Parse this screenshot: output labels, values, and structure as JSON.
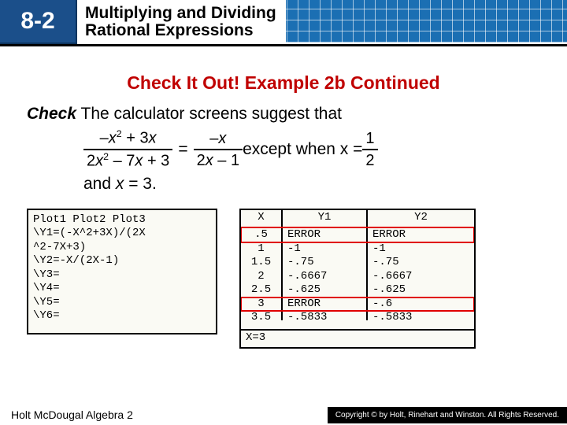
{
  "header": {
    "lesson": "8-2",
    "title_l1": "Multiplying and Dividing",
    "title_l2": "Rational Expressions"
  },
  "subtitle": "Check It Out! Example 2b Continued",
  "body": {
    "lead_strong": "Check",
    "lead_rest": " The calculator screens suggest that",
    "frac1_num": "–x² + 3x",
    "frac1_den": "2x² – 7x + 3",
    "eq": "=",
    "frac2_num": "–x",
    "frac2_den": "2x – 1",
    "mid": " except when x = ",
    "frac3_num": "1",
    "frac3_den": "2",
    "tail": "and x = 3."
  },
  "screen1": {
    "l1": "Plot1 Plot2 Plot3",
    "l2": "\\Y1=(-X^2+3X)/(2X",
    "l3": "^2-7X+3)",
    "l4": "\\Y2=-X/(2X-1)",
    "l5": "\\Y3=",
    "l6": "\\Y4=",
    "l7": "\\Y5=",
    "l8": "\\Y6="
  },
  "screen2": {
    "h1": "X",
    "h2": "Y1",
    "h3": "Y2",
    "rows": [
      {
        "x": ".5",
        "y1": "ERROR",
        "y2": "ERROR"
      },
      {
        "x": "1",
        "y1": "-1",
        "y2": "-1"
      },
      {
        "x": "1.5",
        "y1": "-.75",
        "y2": "-.75"
      },
      {
        "x": "2",
        "y1": "-.6667",
        "y2": "-.6667"
      },
      {
        "x": "2.5",
        "y1": "-.625",
        "y2": "-.625"
      },
      {
        "x": "3",
        "y1": "ERROR",
        "y2": "-.6"
      },
      {
        "x": "3.5",
        "y1": "-.5833",
        "y2": "-.5833"
      }
    ],
    "footer": "X=3"
  },
  "footer": {
    "publisher": "Holt McDougal Algebra 2",
    "copyright": "Copyright © by Holt, Rinehart and Winston. All Rights Reserved."
  }
}
